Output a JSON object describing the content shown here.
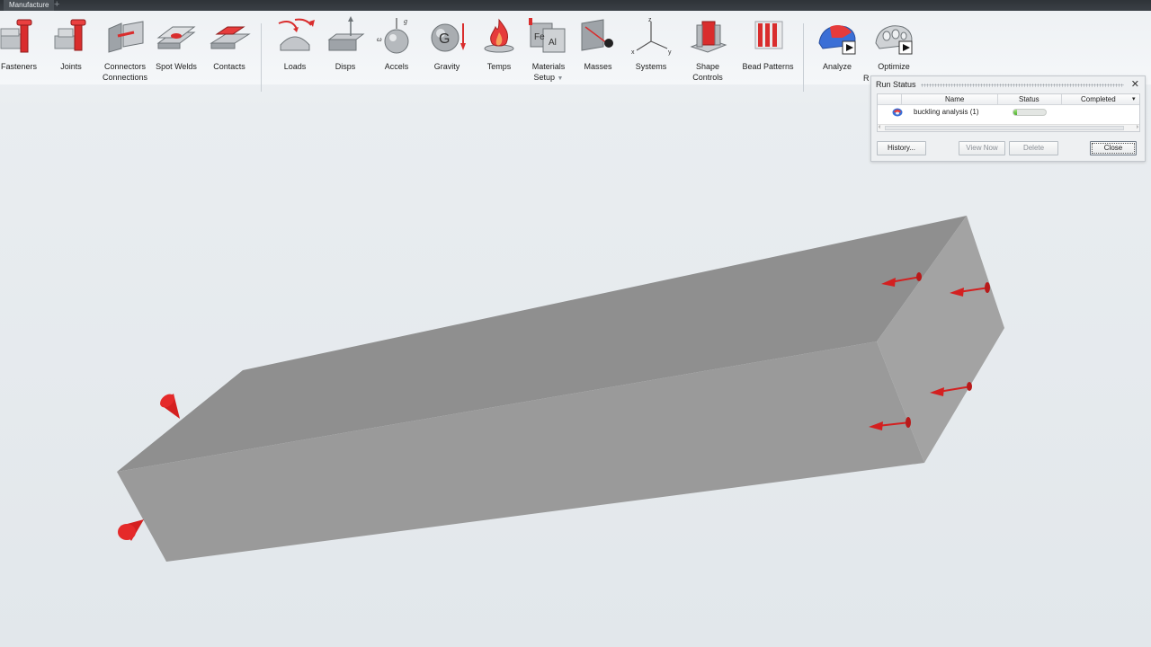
{
  "tabstrip": {
    "active_tab": "Manufacture",
    "add_symbol": "+"
  },
  "ribbon": {
    "tools": [
      {
        "id": "fasteners",
        "label": "Fasteners",
        "icon": "fasteners-icon"
      },
      {
        "id": "joints",
        "label": "Joints",
        "icon": "joints-icon"
      },
      {
        "id": "connectors",
        "label": "Connectors",
        "label2": "Connections",
        "icon": "connectors-icon"
      },
      {
        "id": "spotwelds",
        "label": "Spot Welds",
        "icon": "spot-welds-icon"
      },
      {
        "id": "contacts",
        "label": "Contacts",
        "icon": "contacts-icon"
      },
      {
        "id": "loads",
        "label": "Loads",
        "icon": "loads-icon"
      },
      {
        "id": "disps",
        "label": "Disps",
        "icon": "disps-icon"
      },
      {
        "id": "accels",
        "label": "Accels",
        "icon": "accels-icon"
      },
      {
        "id": "gravity",
        "label": "Gravity",
        "icon": "gravity-icon"
      },
      {
        "id": "temps",
        "label": "Temps",
        "icon": "temps-icon"
      },
      {
        "id": "materials",
        "label": "Materials",
        "label2": "Setup",
        "icon": "materials-icon"
      },
      {
        "id": "masses",
        "label": "Masses",
        "icon": "masses-icon"
      },
      {
        "id": "systems",
        "label": "Systems",
        "icon": "systems-icon"
      },
      {
        "id": "shapecontrols",
        "label": "Shape Controls",
        "icon": "shape-controls-icon"
      },
      {
        "id": "beadpatterns",
        "label": "Bead Patterns",
        "icon": "bead-patterns-icon"
      },
      {
        "id": "analyze",
        "label": "Analyze",
        "icon": "analyze-icon"
      },
      {
        "id": "optimize",
        "label": "Optimize",
        "icon": "optimize-icon"
      }
    ],
    "truncated_label": "R",
    "dropdown_symbol": "▼"
  },
  "run_status": {
    "title": "Run Status",
    "close_symbol": "✕",
    "columns": [
      "Name",
      "Status",
      "Completed"
    ],
    "rows": [
      {
        "name": "buckling analysis (1)",
        "progress": 0.1
      }
    ],
    "buttons": {
      "history": "History...",
      "view_now": "View Now",
      "delete": "Delete",
      "close": "Close"
    }
  },
  "colors": {
    "model_top": "#8e8e8e",
    "model_front": "#9b9b9b",
    "model_end": "#a4a4a4",
    "load_red": "#d42020",
    "accent_red": "#e03030"
  }
}
